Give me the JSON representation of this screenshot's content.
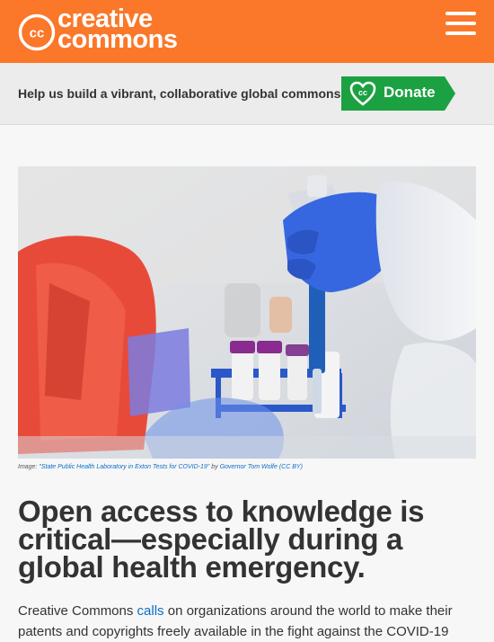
{
  "header": {
    "logo_line1": "creative",
    "logo_line2": "commons",
    "cc_mark": "cc",
    "menu_icon": "hamburger-menu-icon",
    "background_color": "#fb7729"
  },
  "banner": {
    "text": "Help us build a vibrant, collaborative global commons",
    "donate_label": "Donate",
    "donate_icon": "cc-heart-icon",
    "donate_color": "#1ba141"
  },
  "hero": {
    "caption_prefix": "Image: ",
    "caption_title": "\"State Public Health Laboratory in Exton Tests for COVID-19\"",
    "caption_by": " by ",
    "caption_author": "Governor Tom Wolfe (CC BY)"
  },
  "article": {
    "headline": "Open access to knowledge is critical—especially during a global health emergency.",
    "body_prefix": "Creative Commons ",
    "body_link": "calls",
    "body_suffix": " on organizations around the world to make their patents and copyrights freely available in the fight against the COVID-19"
  }
}
